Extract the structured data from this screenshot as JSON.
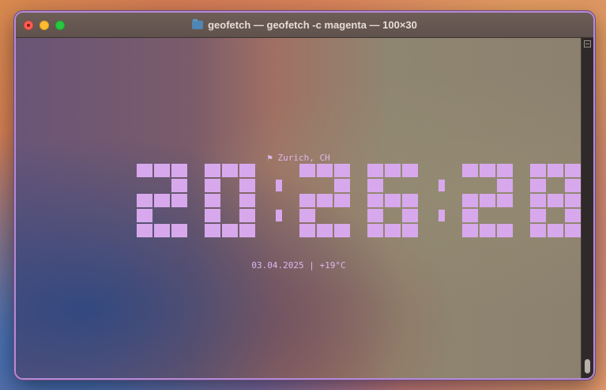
{
  "window": {
    "title": "geofetch — geofetch -c magenta — 100×30",
    "folder_icon": "folder-icon",
    "traffic_lights": [
      "close",
      "minimize",
      "zoom"
    ]
  },
  "terminal": {
    "flag_icon": "⚑",
    "location": "Zurich, CH",
    "time": "20:26:28",
    "date": "03.04.2025",
    "separator": "|",
    "temperature": "+19°C",
    "text_color": "#d7a9ec"
  }
}
